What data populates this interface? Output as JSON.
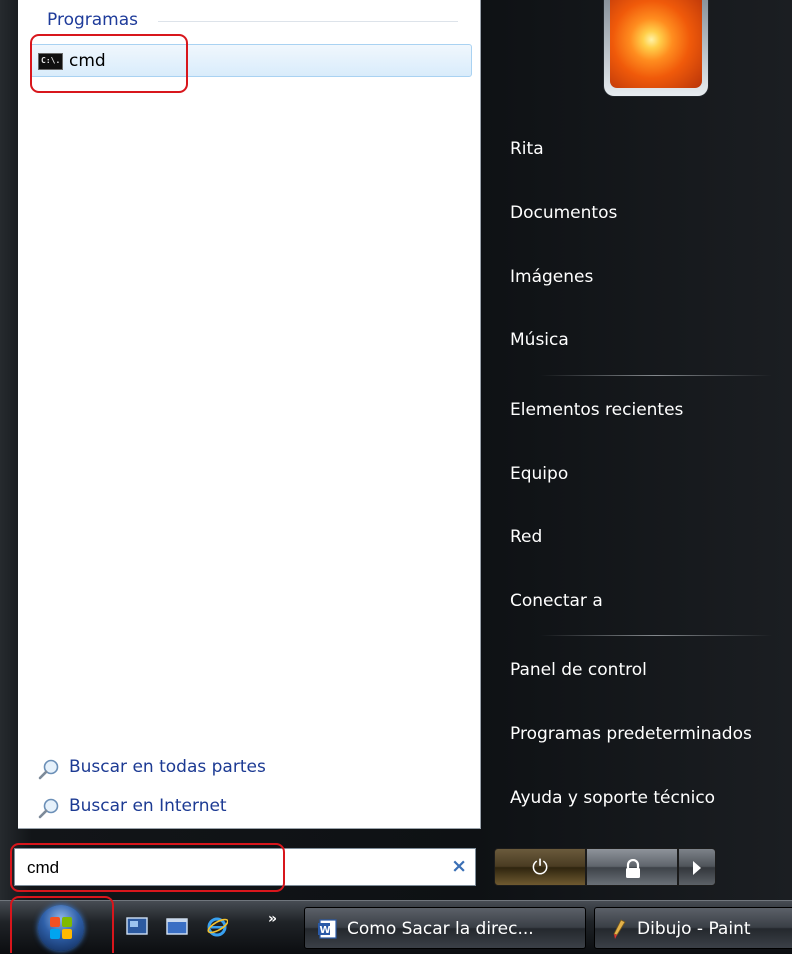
{
  "start_menu": {
    "programs_section_label": "Programas",
    "programs": [
      {
        "label": "cmd",
        "icon": "cmd-icon",
        "icon_text": "C:\\."
      }
    ],
    "search_links": [
      {
        "label": "Buscar en todas partes",
        "icon": "magnifier-icon"
      },
      {
        "label": "Buscar en Internet",
        "icon": "magnifier-icon"
      }
    ],
    "search_input": {
      "value": "cmd",
      "clear_glyph": "×"
    },
    "right_items": {
      "user": "Rita",
      "documents": "Documentos",
      "pictures": "Imágenes",
      "music": "Música",
      "recent": "Elementos recientes",
      "computer": "Equipo",
      "network": "Red",
      "connect": "Conectar a",
      "control_panel": "Panel de control",
      "default_programs": "Programas predeterminados",
      "help": "Ayuda y soporte técnico"
    },
    "power_buttons": {
      "power_glyph": "⏻",
      "lock": "lock-icon",
      "options": "arrow-right-icon"
    }
  },
  "taskbar": {
    "start_orb": "windows-logo-icon",
    "quick_launch": [
      "show-desktop-icon",
      "switch-windows-icon",
      "internet-explorer-icon"
    ],
    "quick_launch_more": "»",
    "buttons": [
      {
        "label": "Como Sacar la direc...",
        "icon": "word-icon"
      },
      {
        "label": "Dibujo - Paint",
        "icon": "paint-icon"
      }
    ]
  },
  "colors": {
    "annotation_red": "#d8161c",
    "link_blue": "#1c3a93",
    "menu_right_bg": "#0e1114",
    "selection_bg": "#d9ecfb"
  }
}
